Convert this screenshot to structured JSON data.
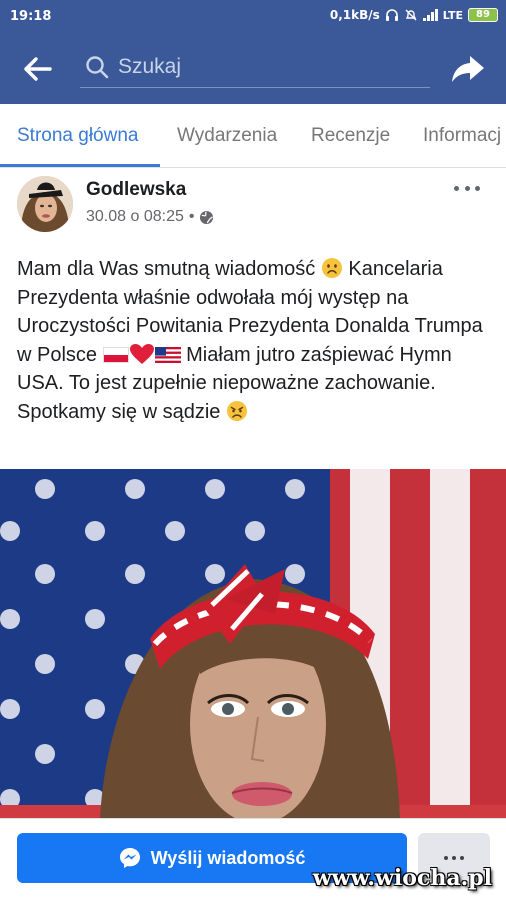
{
  "status_bar": {
    "time": "19:18",
    "network_speed": "0,1kB/s",
    "network_type": "LTE",
    "battery": "89",
    "headphones_icon": "headphones-icon",
    "mute_icon": "bell-off-icon",
    "signal_icon": "signal-icon"
  },
  "header": {
    "back_icon": "arrow-left-icon",
    "search_placeholder": "Szukaj",
    "search_value": "",
    "search_icon": "search-icon",
    "share_icon": "share-icon",
    "background_color": "#3b5998"
  },
  "tabs": [
    {
      "label": "Strona główna",
      "active": true
    },
    {
      "label": "Wydarzenia",
      "active": false
    },
    {
      "label": "Recenzje",
      "active": false
    },
    {
      "label": "Informacj",
      "active": false
    }
  ],
  "post": {
    "author": "Godlewska",
    "date": "30.08 o 08:25",
    "separator": "•",
    "privacy_icon": "globe-icon",
    "more_icon": "more-horizontal-icon",
    "text_parts": {
      "part1": "Mam dla Was smutną wiadomość ",
      "part2": " Kancelaria Prezydenta właśnie odwołała mój występ na Uroczystości Powitania Prezydenta Donalda Trumpa w Polsce ",
      "part3": " Miałam jutro zaśpiewać Hymn USA. To jest zupełnie niepoważne zachowanie. Spotkamy się w sądzie "
    },
    "emojis": [
      "frowning-face-icon",
      "flag-poland-icon",
      "red-heart-icon",
      "flag-usa-icon",
      "persevering-face-icon"
    ]
  },
  "bottom_bar": {
    "message_button_label": "Wyślij wiadomość",
    "message_icon": "messenger-icon",
    "more_button_icon": "more-horizontal-icon",
    "accent_color": "#1877f2"
  },
  "watermark": "www.wiocha.pl"
}
